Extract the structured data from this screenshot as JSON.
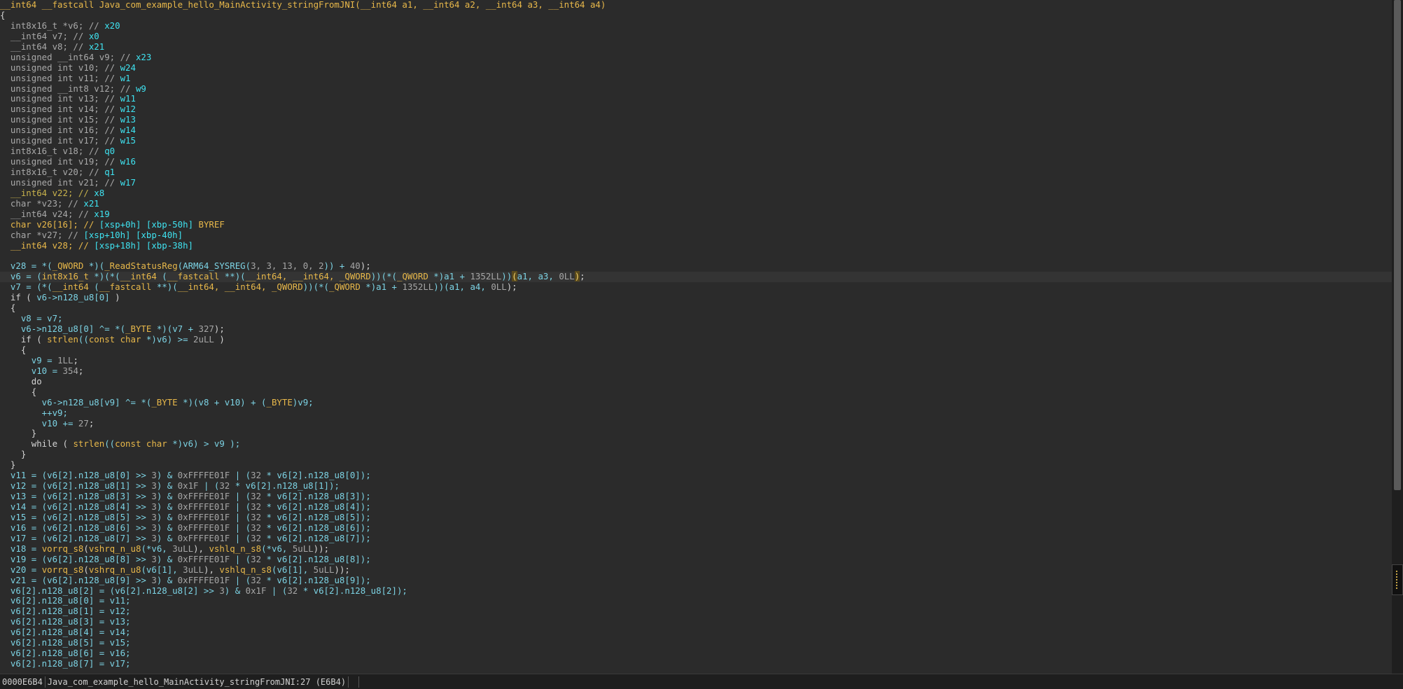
{
  "status": {
    "address": "0000E6B4",
    "location": "Java_com_example_hello_MainActivity_stringFromJNI:27 (E6B4)"
  },
  "highlighted_line": 27,
  "code_lines": [
    [
      [
        "__int64 __fastcall Java_com_example_hello_MainActivity_stringFromJNI(__int64 a1, __int64 a2, __int64 a3, __int64 a4)",
        "c-type"
      ]
    ],
    [
      [
        "{",
        ""
      ]
    ],
    [
      [
        "  int8x16_t *v6; // ",
        "c-pale"
      ],
      [
        "x20",
        "c-reg"
      ]
    ],
    [
      [
        "  __int64 v7; // ",
        "c-pale"
      ],
      [
        "x0",
        "c-reg"
      ]
    ],
    [
      [
        "  __int64 v8; // ",
        "c-pale"
      ],
      [
        "x21",
        "c-reg"
      ]
    ],
    [
      [
        "  unsigned __int64 v9; // ",
        "c-pale"
      ],
      [
        "x23",
        "c-reg"
      ]
    ],
    [
      [
        "  unsigned int v10; // ",
        "c-pale"
      ],
      [
        "w24",
        "c-reg"
      ]
    ],
    [
      [
        "  unsigned int v11; // ",
        "c-pale"
      ],
      [
        "w1",
        "c-reg"
      ]
    ],
    [
      [
        "  unsigned __int8 v12; // ",
        "c-pale"
      ],
      [
        "w9",
        "c-reg"
      ]
    ],
    [
      [
        "  unsigned int v13; // ",
        "c-pale"
      ],
      [
        "w11",
        "c-reg"
      ]
    ],
    [
      [
        "  unsigned int v14; // ",
        "c-pale"
      ],
      [
        "w12",
        "c-reg"
      ]
    ],
    [
      [
        "  unsigned int v15; // ",
        "c-pale"
      ],
      [
        "w13",
        "c-reg"
      ]
    ],
    [
      [
        "  unsigned int v16; // ",
        "c-pale"
      ],
      [
        "w14",
        "c-reg"
      ]
    ],
    [
      [
        "  unsigned int v17; // ",
        "c-pale"
      ],
      [
        "w15",
        "c-reg"
      ]
    ],
    [
      [
        "  int8x16_t v18; // ",
        "c-pale"
      ],
      [
        "q0",
        "c-reg"
      ]
    ],
    [
      [
        "  unsigned int v19; // ",
        "c-pale"
      ],
      [
        "w16",
        "c-reg"
      ]
    ],
    [
      [
        "  int8x16_t v20; // ",
        "c-pale"
      ],
      [
        "q1",
        "c-reg"
      ]
    ],
    [
      [
        "  unsigned int v21; // ",
        "c-pale"
      ],
      [
        "w17",
        "c-reg"
      ]
    ],
    [
      [
        "  __int64 v22; // ",
        "c-decl"
      ],
      [
        "x8",
        "c-reg"
      ]
    ],
    [
      [
        "  char *v23; // ",
        "c-pale"
      ],
      [
        "x21",
        "c-reg"
      ]
    ],
    [
      [
        "  __int64 v24; // ",
        "c-pale"
      ],
      [
        "x19",
        "c-reg"
      ]
    ],
    [
      [
        "  char v26[16]; // ",
        "c-type"
      ],
      [
        "[xsp+0h] [xbp-50h] ",
        "c-reg"
      ],
      [
        "BYREF",
        "c-byref"
      ]
    ],
    [
      [
        "  char *v27; // ",
        "c-pale"
      ],
      [
        "[xsp+10h] [xbp-40h]",
        "c-reg"
      ]
    ],
    [
      [
        "  __int64 v28; // ",
        "c-type"
      ],
      [
        "[xsp+18h] [xbp-38h]",
        "c-reg"
      ]
    ],
    [
      [
        "",
        ""
      ]
    ],
    [
      [
        "  v28 = *(",
        "c-var"
      ],
      [
        "_QWORD",
        "c-type"
      ],
      [
        " *)(",
        "c-var"
      ],
      [
        "_ReadStatusReg",
        "c-type"
      ],
      [
        "(ARM64_SYSREG(",
        "c-var"
      ],
      [
        "3, 3, 13, 0, 2",
        "c-num"
      ],
      [
        ")) + ",
        "c-var"
      ],
      [
        "40",
        "c-num"
      ],
      [
        ");",
        ""
      ]
    ],
    [
      [
        "  v6 = (",
        "c-var"
      ],
      [
        "int8x16_t",
        "c-type"
      ],
      [
        " *)(*(",
        "c-var"
      ],
      [
        "__int64",
        "c-type"
      ],
      [
        " (",
        "c-var"
      ],
      [
        "__fastcall",
        "c-type"
      ],
      [
        " **)(",
        "c-var"
      ],
      [
        "__int64, __int64, _QWORD",
        "c-type"
      ],
      [
        "))(*(",
        "c-var"
      ],
      [
        "_QWORD",
        "c-type"
      ],
      [
        " *)a1 + ",
        "c-var"
      ],
      [
        "1352LL",
        "c-num"
      ],
      [
        "))",
        "c-var"
      ],
      [
        "(",
        "c-bracket-hl"
      ],
      [
        "a1, a3, ",
        "c-var"
      ],
      [
        "0LL",
        "c-num"
      ],
      [
        ")",
        "c-bracket-hl"
      ],
      [
        ";",
        ""
      ]
    ],
    [
      [
        "  v7 = (*(",
        "c-var"
      ],
      [
        "__int64",
        "c-type"
      ],
      [
        " (",
        "c-var"
      ],
      [
        "__fastcall",
        "c-type"
      ],
      [
        " **)(",
        "c-var"
      ],
      [
        "__int64, __int64, _QWORD",
        "c-type"
      ],
      [
        "))(*(",
        "c-var"
      ],
      [
        "_QWORD",
        "c-type"
      ],
      [
        " *)a1 + ",
        "c-var"
      ],
      [
        "1352LL",
        "c-num"
      ],
      [
        "))(a1, a4, ",
        "c-var"
      ],
      [
        "0LL",
        "c-num"
      ],
      [
        ");",
        ""
      ]
    ],
    [
      [
        "  if ( ",
        ""
      ],
      [
        "v6->n128_u8[0]",
        "c-var"
      ],
      [
        " )",
        ""
      ]
    ],
    [
      [
        "  {",
        ""
      ]
    ],
    [
      [
        "    v8 = v7;",
        "c-var"
      ]
    ],
    [
      [
        "    v6->n128_u8[0] ^= *(",
        "c-var"
      ],
      [
        "_BYTE",
        "c-type"
      ],
      [
        " *)(v7 + ",
        "c-var"
      ],
      [
        "327",
        "c-num"
      ],
      [
        ");",
        ""
      ]
    ],
    [
      [
        "    if ( ",
        ""
      ],
      [
        "strlen",
        "c-type"
      ],
      [
        "((",
        "c-var"
      ],
      [
        "const char",
        "c-type"
      ],
      [
        " *)v6) >= ",
        "c-var"
      ],
      [
        "2uLL",
        "c-num"
      ],
      [
        " )",
        ""
      ]
    ],
    [
      [
        "    {",
        ""
      ]
    ],
    [
      [
        "      v9 = ",
        "c-var"
      ],
      [
        "1LL",
        "c-num"
      ],
      [
        ";",
        ""
      ]
    ],
    [
      [
        "      v10 = ",
        "c-var"
      ],
      [
        "354",
        "c-num"
      ],
      [
        ";",
        ""
      ]
    ],
    [
      [
        "      do",
        ""
      ]
    ],
    [
      [
        "      {",
        ""
      ]
    ],
    [
      [
        "        v6->n128_u8[v9] ^= *(",
        "c-var"
      ],
      [
        "_BYTE",
        "c-type"
      ],
      [
        " *)(v8 + v10) + (",
        "c-var"
      ],
      [
        "_BYTE",
        "c-type"
      ],
      [
        ")v9;",
        "c-var"
      ]
    ],
    [
      [
        "        ++v9;",
        "c-var"
      ]
    ],
    [
      [
        "        v10 += ",
        "c-var"
      ],
      [
        "27",
        "c-num"
      ],
      [
        ";",
        ""
      ]
    ],
    [
      [
        "      }",
        ""
      ]
    ],
    [
      [
        "      while ( ",
        ""
      ],
      [
        "strlen",
        "c-type"
      ],
      [
        "((",
        "c-var"
      ],
      [
        "const char",
        "c-type"
      ],
      [
        " *)v6) > v9 );",
        "c-var"
      ]
    ],
    [
      [
        "    }",
        ""
      ]
    ],
    [
      [
        "  }",
        ""
      ]
    ],
    [
      [
        "  v11 = (v6[2].n128_u8[0] >> ",
        "c-var"
      ],
      [
        "3",
        "c-num"
      ],
      [
        ") & ",
        "c-var"
      ],
      [
        "0xFFFFE01F",
        "c-num"
      ],
      [
        " | (",
        "c-var"
      ],
      [
        "32",
        "c-num"
      ],
      [
        " * v6[2].n128_u8[0]);",
        "c-var"
      ]
    ],
    [
      [
        "  v12 = (v6[2].n128_u8[1] >> ",
        "c-var"
      ],
      [
        "3",
        "c-num"
      ],
      [
        ") & ",
        "c-var"
      ],
      [
        "0x1F",
        "c-num"
      ],
      [
        " | (",
        "c-var"
      ],
      [
        "32",
        "c-num"
      ],
      [
        " * v6[2].n128_u8[1]);",
        "c-var"
      ]
    ],
    [
      [
        "  v13 = (v6[2].n128_u8[3] >> ",
        "c-var"
      ],
      [
        "3",
        "c-num"
      ],
      [
        ") & ",
        "c-var"
      ],
      [
        "0xFFFFE01F",
        "c-num"
      ],
      [
        " | (",
        "c-var"
      ],
      [
        "32",
        "c-num"
      ],
      [
        " * v6[2].n128_u8[3]);",
        "c-var"
      ]
    ],
    [
      [
        "  v14 = (v6[2].n128_u8[4] >> ",
        "c-var"
      ],
      [
        "3",
        "c-num"
      ],
      [
        ") & ",
        "c-var"
      ],
      [
        "0xFFFFE01F",
        "c-num"
      ],
      [
        " | (",
        "c-var"
      ],
      [
        "32",
        "c-num"
      ],
      [
        " * v6[2].n128_u8[4]);",
        "c-var"
      ]
    ],
    [
      [
        "  v15 = (v6[2].n128_u8[5] >> ",
        "c-var"
      ],
      [
        "3",
        "c-num"
      ],
      [
        ") & ",
        "c-var"
      ],
      [
        "0xFFFFE01F",
        "c-num"
      ],
      [
        " | (",
        "c-var"
      ],
      [
        "32",
        "c-num"
      ],
      [
        " * v6[2].n128_u8[5]);",
        "c-var"
      ]
    ],
    [
      [
        "  v16 = (v6[2].n128_u8[6] >> ",
        "c-var"
      ],
      [
        "3",
        "c-num"
      ],
      [
        ") & ",
        "c-var"
      ],
      [
        "0xFFFFE01F",
        "c-num"
      ],
      [
        " | (",
        "c-var"
      ],
      [
        "32",
        "c-num"
      ],
      [
        " * v6[2].n128_u8[6]);",
        "c-var"
      ]
    ],
    [
      [
        "  v17 = (v6[2].n128_u8[7] >> ",
        "c-var"
      ],
      [
        "3",
        "c-num"
      ],
      [
        ") & ",
        "c-var"
      ],
      [
        "0xFFFFE01F",
        "c-num"
      ],
      [
        " | (",
        "c-var"
      ],
      [
        "32",
        "c-num"
      ],
      [
        " * v6[2].n128_u8[7]);",
        "c-var"
      ]
    ],
    [
      [
        "  v18 = ",
        "c-var"
      ],
      [
        "vorrq_s8",
        "c-type"
      ],
      [
        "(",
        ""
      ],
      [
        "vshrq_n_u8",
        "c-type"
      ],
      [
        "(*v6, ",
        "c-var"
      ],
      [
        "3uLL",
        "c-num"
      ],
      [
        "), ",
        ""
      ],
      [
        "vshlq_n_s8",
        "c-type"
      ],
      [
        "(*v6, ",
        "c-var"
      ],
      [
        "5uLL",
        "c-num"
      ],
      [
        "));",
        ""
      ]
    ],
    [
      [
        "  v19 = (v6[2].n128_u8[8] >> ",
        "c-var"
      ],
      [
        "3",
        "c-num"
      ],
      [
        ") & ",
        "c-var"
      ],
      [
        "0xFFFFE01F",
        "c-num"
      ],
      [
        " | (",
        "c-var"
      ],
      [
        "32",
        "c-num"
      ],
      [
        " * v6[2].n128_u8[8]);",
        "c-var"
      ]
    ],
    [
      [
        "  v20 = ",
        "c-var"
      ],
      [
        "vorrq_s8",
        "c-type"
      ],
      [
        "(",
        ""
      ],
      [
        "vshrq_n_u8",
        "c-type"
      ],
      [
        "(v6[1], ",
        "c-var"
      ],
      [
        "3uLL",
        "c-num"
      ],
      [
        "), ",
        ""
      ],
      [
        "vshlq_n_s8",
        "c-type"
      ],
      [
        "(v6[1], ",
        "c-var"
      ],
      [
        "5uLL",
        "c-num"
      ],
      [
        "));",
        ""
      ]
    ],
    [
      [
        "  v21 = (v6[2].n128_u8[9] >> ",
        "c-var"
      ],
      [
        "3",
        "c-num"
      ],
      [
        ") & ",
        "c-var"
      ],
      [
        "0xFFFFE01F",
        "c-num"
      ],
      [
        " | (",
        "c-var"
      ],
      [
        "32",
        "c-num"
      ],
      [
        " * v6[2].n128_u8[9]);",
        "c-var"
      ]
    ],
    [
      [
        "  v6[2].n128_u8[2] = (v6[2].n128_u8[2] >> ",
        "c-var"
      ],
      [
        "3",
        "c-num"
      ],
      [
        ") & ",
        "c-var"
      ],
      [
        "0x1F",
        "c-num"
      ],
      [
        " | (",
        "c-var"
      ],
      [
        "32",
        "c-num"
      ],
      [
        " * v6[2].n128_u8[2]);",
        "c-var"
      ]
    ],
    [
      [
        "  v6[2].n128_u8[0] = v11;",
        "c-var"
      ]
    ],
    [
      [
        "  v6[2].n128_u8[1] = v12;",
        "c-var"
      ]
    ],
    [
      [
        "  v6[2].n128_u8[3] = v13;",
        "c-var"
      ]
    ],
    [
      [
        "  v6[2].n128_u8[4] = v14;",
        "c-var"
      ]
    ],
    [
      [
        "  v6[2].n128_u8[5] = v15;",
        "c-var"
      ]
    ],
    [
      [
        "  v6[2].n128_u8[6] = v16;",
        "c-var"
      ]
    ],
    [
      [
        "  v6[2].n128_u8[7] = v17;",
        "c-var"
      ]
    ]
  ]
}
